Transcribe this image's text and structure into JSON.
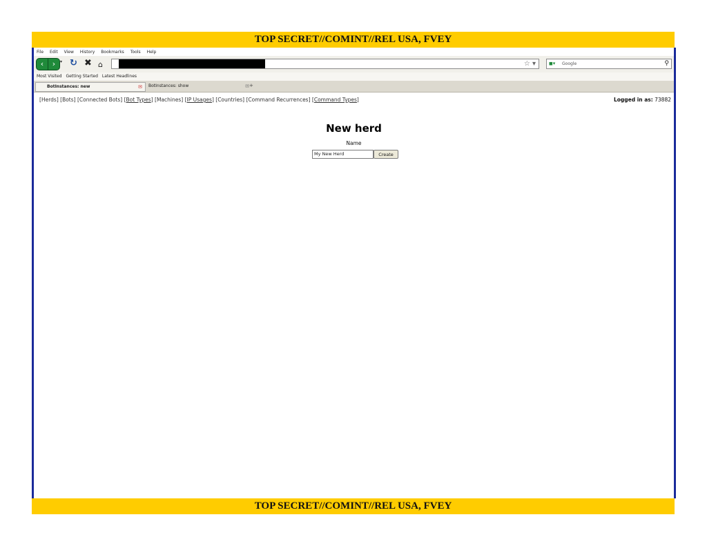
{
  "classification": "TOP SECRET//COMINT//REL USA, FVEY",
  "browser": {
    "menu": [
      "File",
      "Edit",
      "View",
      "History",
      "Bookmarks",
      "Tools",
      "Help"
    ],
    "search_placeholder": "Google",
    "bookmarks": [
      "Most Visited",
      "Getting Started",
      "Latest Headlines"
    ],
    "tabs": [
      {
        "label": "BotInstances: new",
        "active": true
      },
      {
        "label": "BotInstances: show",
        "active": false
      }
    ],
    "new_tab": "+"
  },
  "page": {
    "nav": [
      "Herds",
      "Bots",
      "Connected Bots",
      "Bot Types",
      "Machines",
      "IP Usages",
      "Countries",
      "Command Recurrences",
      "Command Types"
    ],
    "logged_in_label": "Logged in as:",
    "logged_in_user": "73882",
    "title": "New herd",
    "name_label": "Name",
    "name_value": "My New Herd",
    "create_button": "Create"
  },
  "colors": {
    "banner": "#ffcc00",
    "frame_border": "#1a2a9a",
    "nav_buttons": "#1f8a3a"
  }
}
